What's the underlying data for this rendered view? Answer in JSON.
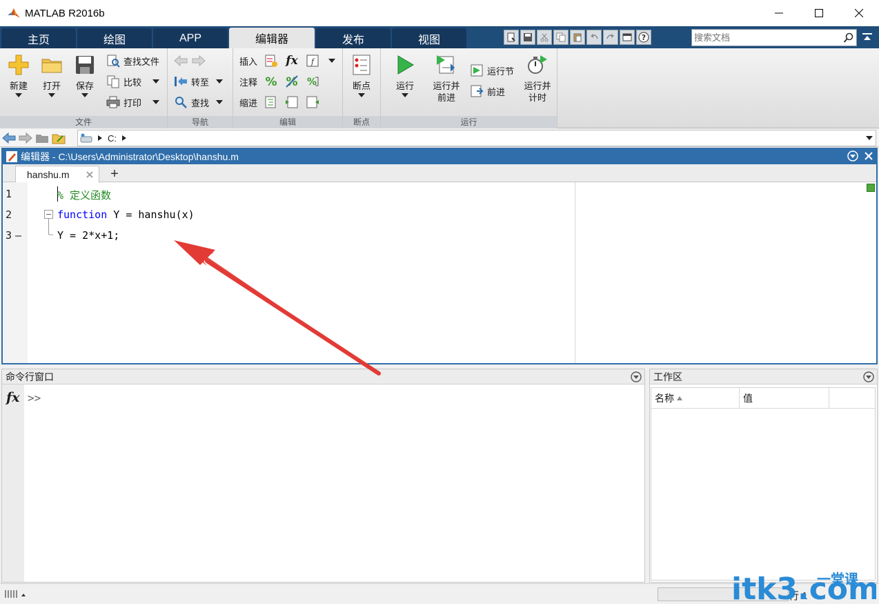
{
  "window": {
    "title": "MATLAB R2016b"
  },
  "tabs": [
    {
      "label": "主页"
    },
    {
      "label": "绘图"
    },
    {
      "label": "APP"
    },
    {
      "label": "编辑器"
    },
    {
      "label": "发布"
    },
    {
      "label": "视图"
    }
  ],
  "search": {
    "placeholder": "搜索文档"
  },
  "ribbon": {
    "file_group": {
      "label": "文件",
      "new": "新建",
      "open": "打开",
      "save": "保存",
      "find_files": "查找文件",
      "compare": "比较",
      "print": "打印"
    },
    "nav_group": {
      "label": "导航",
      "goto": "转至",
      "find": "查找"
    },
    "edit_group": {
      "label": "编辑",
      "insert": "插入",
      "comment": "注释",
      "indent": "缩进",
      "fx": "fx"
    },
    "breakpoint_group": {
      "label": "断点",
      "breakpoints": "断点"
    },
    "run_group": {
      "label": "运行",
      "run": "运行",
      "run_advance_1": "运行并",
      "run_advance_2": "前进",
      "run_section": "运行节",
      "advance": "前进",
      "run_time_1": "运行并",
      "run_time_2": "计时"
    }
  },
  "address": {
    "path": "C:"
  },
  "editor": {
    "title": "编辑器 - C:\\Users\\Administrator\\Desktop\\hanshu.m",
    "tab_name": "hanshu.m",
    "add_tab": "+",
    "lines": [
      {
        "num": "1",
        "text": "% 定义函数"
      },
      {
        "num": "2",
        "kw": "function",
        "text": " Y = hanshu(x)"
      },
      {
        "num": "3",
        "text": "Y = 2*x+1;",
        "dash": "—"
      }
    ]
  },
  "command_window": {
    "title": "命令行窗口",
    "fx": "fx",
    "prompt": ">>"
  },
  "workspace": {
    "title": "工作区",
    "columns": [
      {
        "label": "名称"
      },
      {
        "label": "值"
      }
    ]
  },
  "status": {
    "position": "行 1"
  },
  "watermark": {
    "text": "itk3.com",
    "cn": "一堂课"
  },
  "colors": {
    "accent": "#2f6eab",
    "tabstrip": "#1f4d7a",
    "arrow": "#e23b36",
    "watermark": "#2a8bd6"
  }
}
